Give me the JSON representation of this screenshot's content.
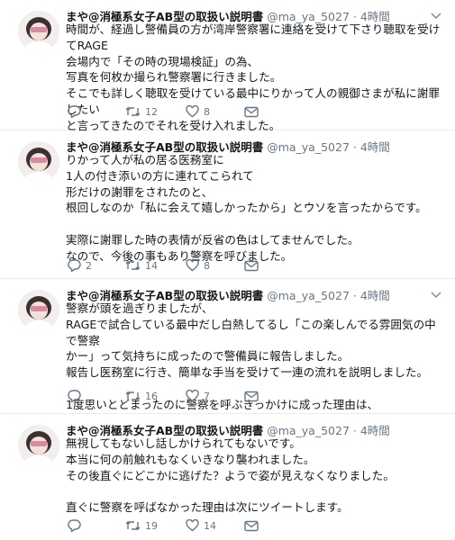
{
  "tweets": [
    {
      "name": "まや@消極系女子AB型の取扱い説明書",
      "handle": "@ma_ya_5027",
      "time": "4時間",
      "text": "時間が、経過し警備員の方が湾岸警察署に連絡を受けて下さり聴取を受けてRAGE\n会場内で「その時の現場検証」の為、\n写真を何枚か撮られ警察署に行きました。\nそこでも詳しく聴取を受けている最中にりかって人の親御さまが私に謝罪したい\nと言ってきたのでそれを受け入れました。",
      "replies": "",
      "retweets": "12",
      "likes": "8"
    },
    {
      "name": "まや@消極系女子AB型の取扱い説明書",
      "handle": "@ma_ya_5027",
      "time": "4時間",
      "text": "りかって人が私の居る医務室に\n1人の付き添いの方に連れてこられて\n形だけの謝罪をされたのと、\n根回しなのか「私に会えて嬉しかったから」とウソを言ったからです。\n\n実際に謝罪した時の表情が反省の色はしてませんでした。\nなので、今後の事もあり警察を呼びました。",
      "replies": "2",
      "retweets": "14",
      "likes": "8"
    },
    {
      "name": "まや@消極系女子AB型の取扱い説明書",
      "handle": "@ma_ya_5027",
      "time": "4時間",
      "text": "警察が頭を過ぎりましたが、\nRAGEで試合している最中だし白熱してるし「この楽しんでる雰囲気の中で警察\nかー」って気持ちに成ったので警備員に報告しました。\n報告し医務室に行き、簡単な手当を受けて一連の流れを説明しました。\n\n1度思いとどまったのに警察を呼ぶきっかけに成った理由は、",
      "replies": "",
      "retweets": "16",
      "likes": "7"
    },
    {
      "name": "まや@消極系女子AB型の取扱い説明書",
      "handle": "@ma_ya_5027",
      "time": "4時間",
      "text": "無視してもないし話しかけられてもないです。\n本当に何の前触れもなくいきなり襲われました。\nその後直ぐにどこかに逃げた？ようで姿が見えなくなりました。\n\n直ぐに警察を呼ばなかった理由は次にツイートします。",
      "replies": "",
      "retweets": "19",
      "likes": "14"
    }
  ],
  "icons": {
    "reply": "reply-icon",
    "retweet": "retweet-icon",
    "like": "heart-icon",
    "dm": "envelope-icon",
    "more": "chevron-down-icon"
  },
  "colors": {
    "text": "#14171a",
    "secondary": "#657786",
    "divider": "#e6ecf0"
  }
}
